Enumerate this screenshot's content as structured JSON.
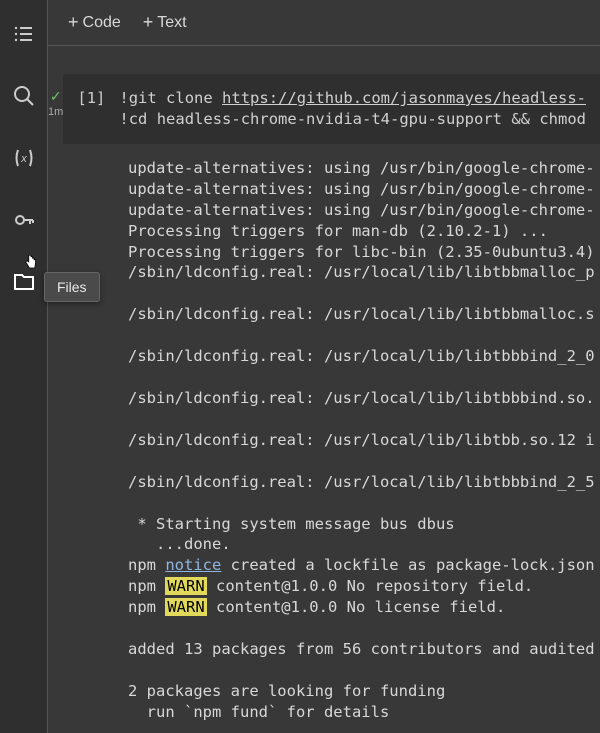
{
  "sidebar": {
    "items": [
      {
        "name": "toc-icon"
      },
      {
        "name": "search-icon"
      },
      {
        "name": "variables-icon"
      },
      {
        "name": "secrets-icon"
      },
      {
        "name": "files-icon"
      }
    ],
    "tooltip": "Files"
  },
  "toolbar": {
    "code_label": "Code",
    "text_label": "Text"
  },
  "cell": {
    "status_time": "1m",
    "prompt": "[1]",
    "line1_bang": "!",
    "line1_cmd": "git clone ",
    "line1_url": "https://github.com/jasonmayes/headless-",
    "line2_bang": "!",
    "line2_cmd": "cd headless-chrome-nvidia-t4-gpu-support && chmod"
  },
  "output": {
    "lines": [
      "update-alternatives: using /usr/bin/google-chrome-",
      "update-alternatives: using /usr/bin/google-chrome-",
      "update-alternatives: using /usr/bin/google-chrome-",
      "Processing triggers for man-db (2.10.2-1) ...",
      "Processing triggers for libc-bin (2.35-0ubuntu3.4)",
      "/sbin/ldconfig.real: /usr/local/lib/libtbbmalloc_p",
      "",
      "/sbin/ldconfig.real: /usr/local/lib/libtbbmalloc.s",
      "",
      "/sbin/ldconfig.real: /usr/local/lib/libtbbbind_2_0",
      "",
      "/sbin/ldconfig.real: /usr/local/lib/libtbbbind.so.",
      "",
      "/sbin/ldconfig.real: /usr/local/lib/libtbb.so.12 i",
      "",
      "/sbin/ldconfig.real: /usr/local/lib/libtbbbind_2_5",
      "",
      " * Starting system message bus dbus",
      "   ...done."
    ],
    "npm1_pre": "npm ",
    "npm1_notice": "notice",
    "npm1_post": " created a lockfile as package-lock.json",
    "npm2_pre": "npm ",
    "npm2_warn": "WARN",
    "npm2_post": " content@1.0.0 No repository field.",
    "npm3_pre": "npm ",
    "npm3_warn": "WARN",
    "npm3_post": " content@1.0.0 No license field.",
    "tail": [
      "",
      "added 13 packages from 56 contributors and audited",
      "",
      "2 packages are looking for funding",
      "  run `npm fund` for details"
    ]
  }
}
